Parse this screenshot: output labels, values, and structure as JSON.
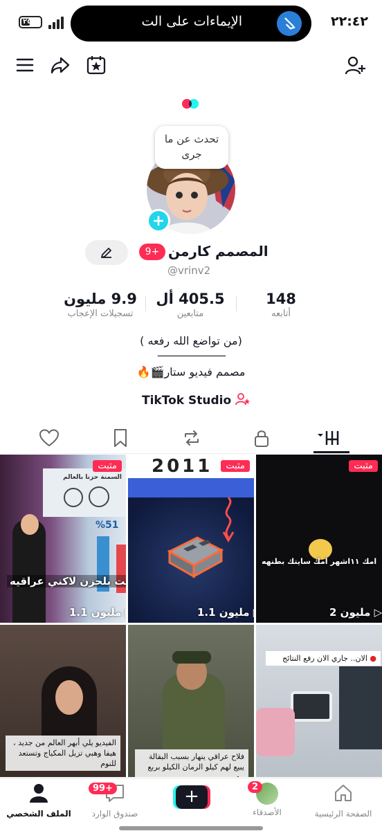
{
  "status_bar": {
    "battery": "٢٥",
    "gesture_text": "الإيماءات على الت",
    "time": "٢٢:٤٢"
  },
  "profile": {
    "speech_bubble": "تحدث عن ما جرى",
    "notification_badge": "9+",
    "display_name": "المصمم كارمن",
    "username": "@vrinv2",
    "stats": {
      "following": {
        "value": "148",
        "label": "أتابعه"
      },
      "followers": {
        "value": "405.5 أل",
        "label": "متابعين"
      },
      "likes": {
        "value": "9.9 مليون",
        "label": "تسجيلات الإعجاب"
      }
    },
    "bio_line1": "(من تواضع الله رفعه )",
    "bio_line2": "———————",
    "bio_line3": "مصمم فيديو ستار🎬🔥",
    "studio_link": "TikTok Studio"
  },
  "tabs": [
    "videos-grid",
    "private",
    "reposts",
    "saved",
    "liked"
  ],
  "videos": [
    {
      "pinned": "مثبت",
      "views": "1.1 مليون",
      "caption": "لست بلحزن لاكني عراقيه",
      "header": "السمنة حزنا بالعالم",
      "percent": "%51"
    },
    {
      "pinned": "مثبت",
      "views": "1.1 مليون",
      "header": "2011"
    },
    {
      "pinned": "مثبت",
      "views": "2 مليون",
      "caption": "امك ١١اشهر امك سايتك بطنهه"
    },
    {
      "caption": "الفيديو يلي أبهر العالم من جديد ، هيفا وهبي تزيل المكياج وتستعد للنوم"
    },
    {
      "caption": "فلاح عراقي ينهار بسبب البقالة يبيع لهم كيلو الرمان الكيلو بربع وهمه"
    },
    {
      "caption": "الان.. جاري الان رفع النتائج"
    }
  ],
  "bottom_nav": {
    "home": "الصفحة الرئيسية",
    "friends": "الأصدقاء",
    "friends_badge": "2",
    "inbox": "صندوق الوارد",
    "inbox_badge": "99+",
    "profile": "الملف الشخصي"
  },
  "colors": {
    "accent": "#fe2c55",
    "cyan": "#25f4ee",
    "plus_badge": "#20d5ec"
  }
}
